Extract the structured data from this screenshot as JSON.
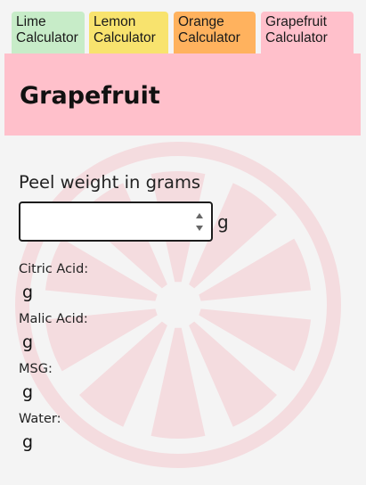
{
  "tabs": [
    {
      "label_line1": "Lime",
      "label_line2": "Calculator",
      "color": "#c7ecc8"
    },
    {
      "label_line1": "Lemon",
      "label_line2": "Calculator",
      "color": "#f8e36e"
    },
    {
      "label_line1": "Orange",
      "label_line2": "Calculator",
      "color": "#ffb25e"
    },
    {
      "label_line1": "Grapefruit",
      "label_line2": "Calculator",
      "color": "#ffc0cb"
    }
  ],
  "active_tab": "Grapefruit Calculator",
  "header": {
    "title": "Grapefruit",
    "background": "#ffc0cb"
  },
  "background_icon": "citrus-slice-watermark",
  "form": {
    "peel_label": "Peel weight in grams",
    "peel_value": "",
    "peel_placeholder": "",
    "unit": "g"
  },
  "results": [
    {
      "label": "Citric Acid:",
      "value": "g"
    },
    {
      "label": "Malic Acid:",
      "value": "g"
    },
    {
      "label": "MSG:",
      "value": "g"
    },
    {
      "label": "Water:",
      "value": "g"
    }
  ]
}
